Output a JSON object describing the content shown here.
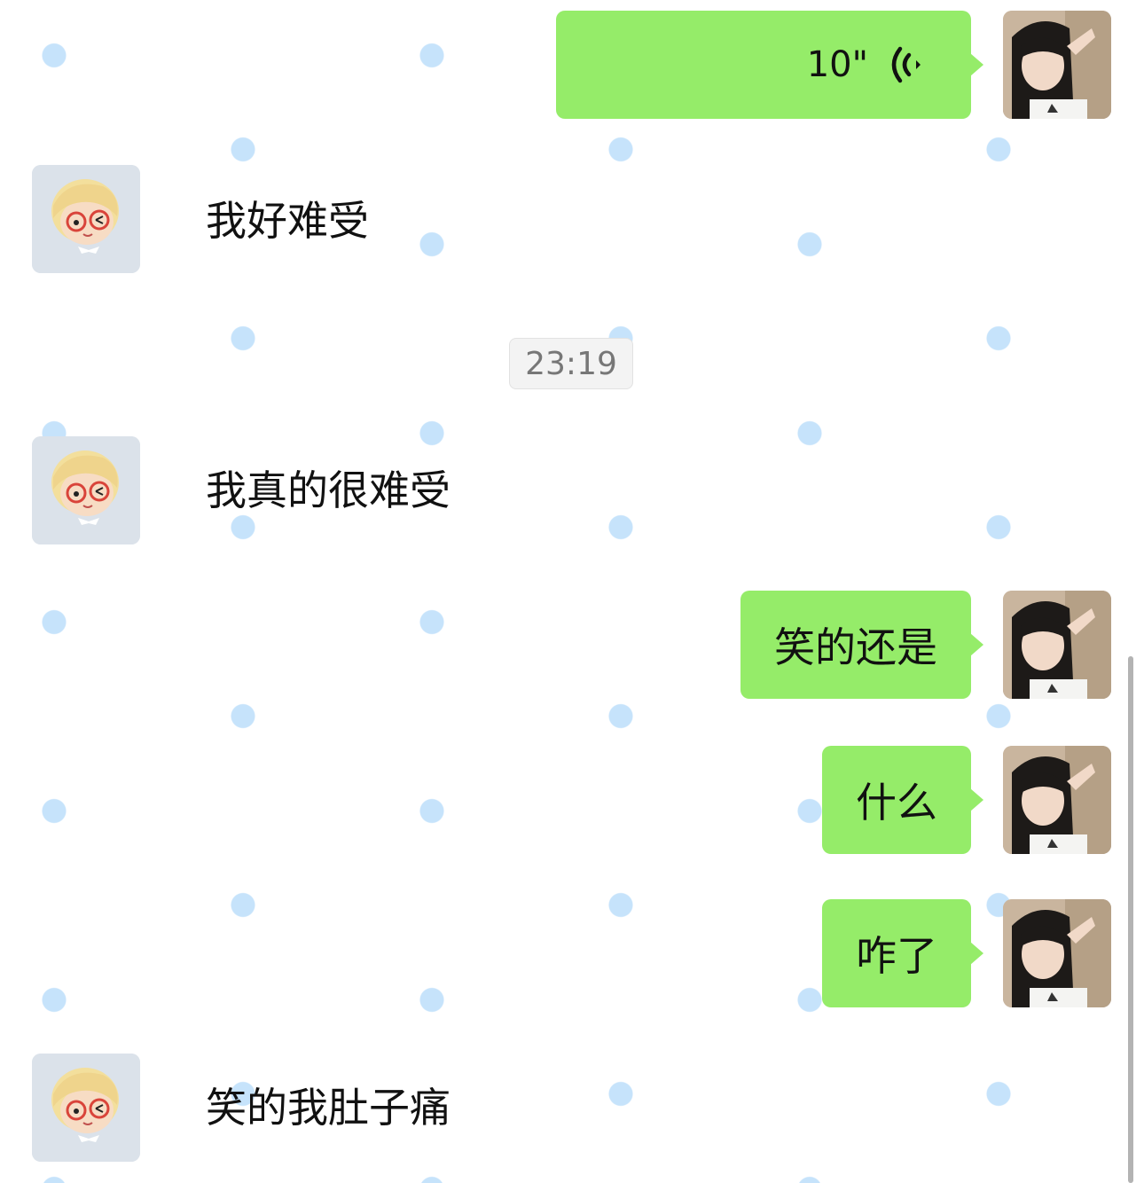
{
  "chat": {
    "messages": [
      {
        "sender": "me",
        "type": "voice",
        "duration": "10\"",
        "icon": "voice-wave-icon"
      },
      {
        "sender": "friend",
        "type": "text",
        "text": "我好难受"
      },
      {
        "type": "timestamp",
        "text": "23:19"
      },
      {
        "sender": "friend",
        "type": "text",
        "text": "我真的很难受"
      },
      {
        "sender": "me",
        "type": "text",
        "text": "笑的还是"
      },
      {
        "sender": "me",
        "type": "text",
        "text": "什么"
      },
      {
        "sender": "me",
        "type": "text",
        "text": "咋了"
      },
      {
        "sender": "friend",
        "type": "text",
        "text": "笑的我肚子痛"
      }
    ]
  },
  "colors": {
    "my_bubble": "#95ec69",
    "background_dot": "#c6e3fb",
    "timestamp_text": "#777777"
  }
}
